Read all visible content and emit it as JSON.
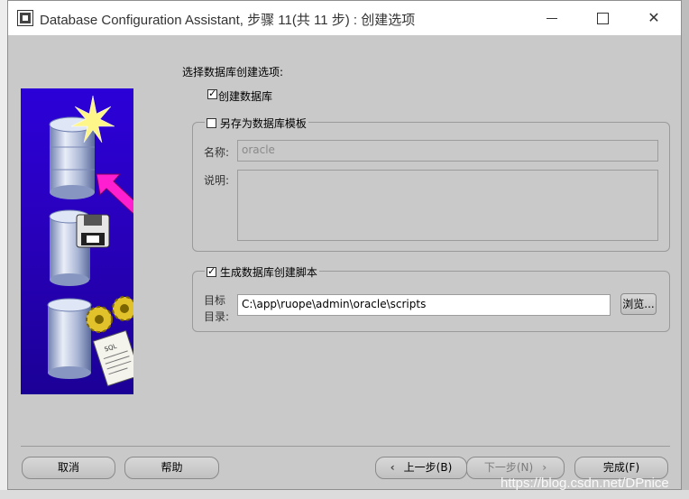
{
  "window": {
    "title": "Database Configuration Assistant, 步骤 11(共 11 步) : 创建选项"
  },
  "main": {
    "section_label": "选择数据库创建选项:",
    "create_db": {
      "label": "创建数据库",
      "checked": true
    },
    "save_template": {
      "label": "另存为数据库模板",
      "checked": false,
      "name_label": "名称:",
      "name_value": "oracle",
      "desc_label": "说明:",
      "desc_value": ""
    },
    "gen_scripts": {
      "label": "生成数据库创建脚本",
      "checked": true,
      "dir_label_1": "目标",
      "dir_label_2": "目录:",
      "dir_value": "C:\\app\\ruope\\admin\\oracle\\scripts",
      "browse_label": "浏览..."
    }
  },
  "footer": {
    "cancel": "取消",
    "help": "帮助",
    "back": "上一步(B)",
    "next": "下一步(N)",
    "finish": "完成(F)"
  },
  "icons": {
    "back": "chevron-left-icon",
    "next": "chevron-right-icon"
  },
  "watermark": "https://blog.csdn.net/DPnice"
}
